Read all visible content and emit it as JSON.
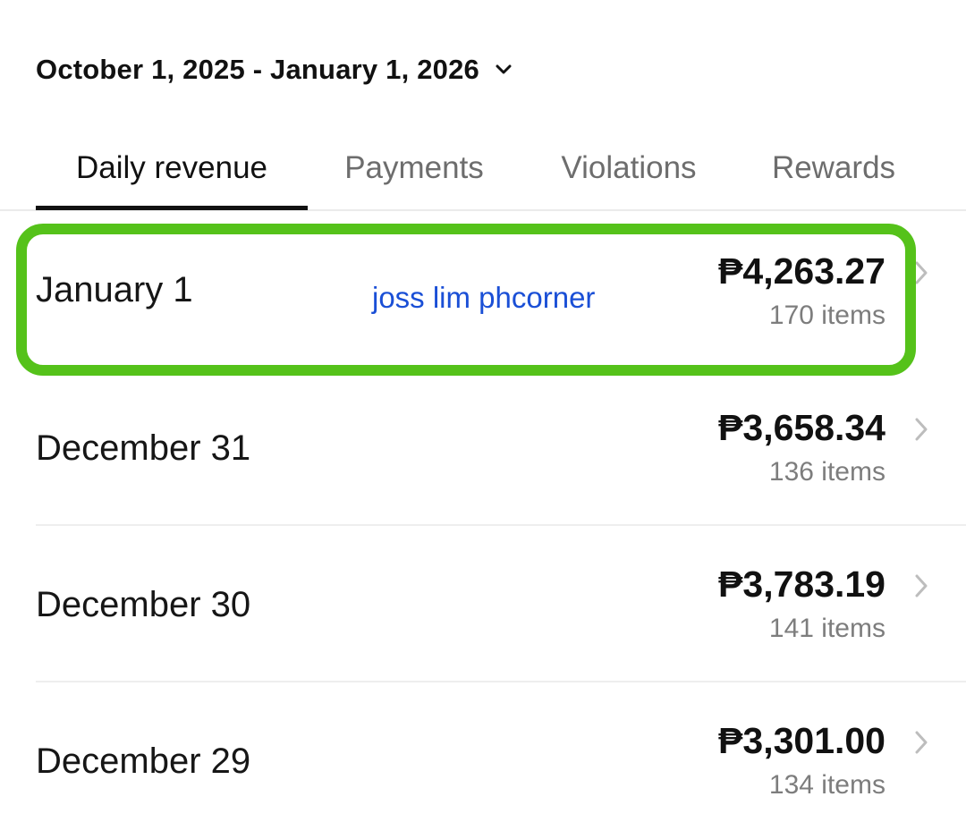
{
  "header": {
    "date_range": "October 1, 2025 - January 1, 2026"
  },
  "tabs": [
    {
      "label": "Daily revenue",
      "active": true
    },
    {
      "label": "Payments",
      "active": false
    },
    {
      "label": "Violations",
      "active": false
    },
    {
      "label": "Rewards",
      "active": false
    }
  ],
  "rows": [
    {
      "date": "January 1",
      "amount": "₱4,263.27",
      "items": "170 items",
      "highlighted": true
    },
    {
      "date": "December 31",
      "amount": "₱3,658.34",
      "items": "136 items"
    },
    {
      "date": "December 30",
      "amount": "₱3,783.19",
      "items": "141 items"
    },
    {
      "date": "December 29",
      "amount": "₱3,301.00",
      "items": "134 items"
    }
  ],
  "watermark": "joss lim phcorner",
  "colors": {
    "highlight_border": "#55c21a",
    "watermark": "#1a4fd6",
    "active_tab": "#111111",
    "inactive_tab": "#6d6d6d"
  },
  "icons": {
    "date_range": "chevron-down-icon",
    "row": "chevron-right-icon"
  }
}
